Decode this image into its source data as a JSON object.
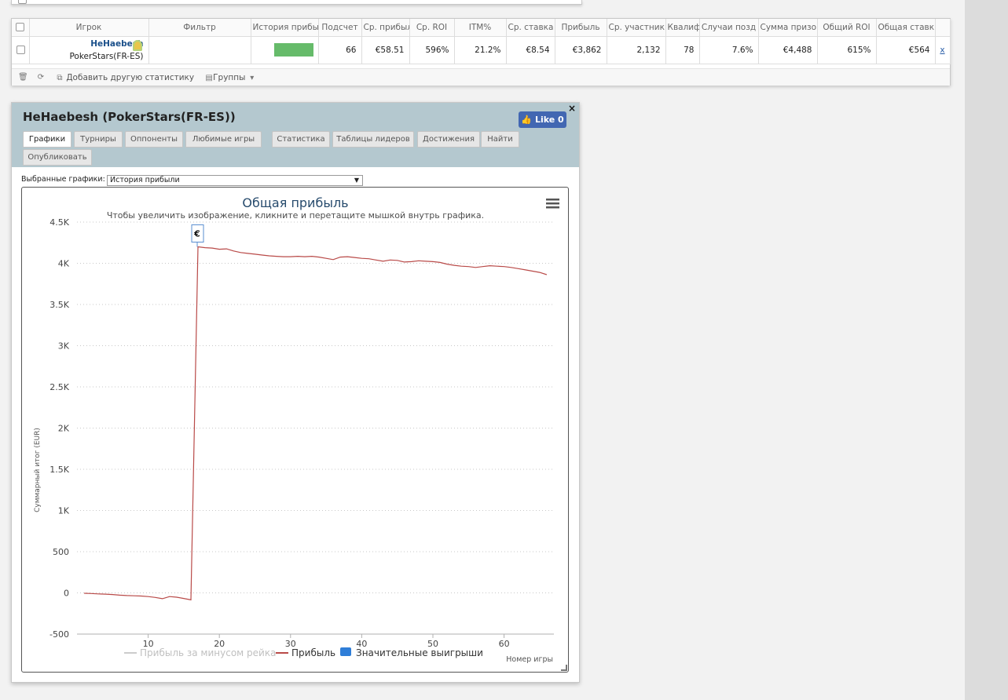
{
  "stats_table": {
    "headers": [
      "Игрок",
      "Фильтр",
      "История прибы",
      "Подсчет",
      "Ср. прибыл",
      "Ср. ROI",
      "ITM%",
      "Ср. ставка",
      "Прибыль",
      "Ср. участник",
      "Квалиф",
      "Случаи позд",
      "Сумма призо",
      "Общий ROI",
      "Общая ставк"
    ],
    "row": {
      "player_name": "HeHaebesh",
      "player_site": "PokerStars(FR-ES)",
      "filter": "",
      "count": "66",
      "avg_profit": "€58.51",
      "avg_roi": "596%",
      "itm": "21.2%",
      "avg_stake": "€8.54",
      "profit": "€3,862",
      "avg_entrants": "2,132",
      "qualif": "78",
      "late_cases": "7.6%",
      "prize_sum": "€4,488",
      "total_roi": "615%",
      "total_stake": "€564",
      "remove_link": "x"
    },
    "footer": {
      "add_stat": "Добавить другую статистику",
      "groups": "Группы"
    }
  },
  "chart_window": {
    "title": "HeHaebesh (PokerStars(FR-ES))",
    "close": "×",
    "like_label": "Like 0",
    "tabs": [
      "Графики",
      "Турниры",
      "Оппоненты",
      "Любимые игры",
      "Статистика",
      "Таблицы лидеров",
      "Достижения",
      "Найти",
      "Опубликовать"
    ],
    "active_tab": "Графики",
    "selector_label": "Выбранные графики:",
    "selector_value": "История прибыли"
  },
  "chart_data": {
    "type": "line",
    "title": "Общая прибыль",
    "subtitle": "Чтобы увеличить изображение, кликните и перетащите мышкой внутрь графика.",
    "xlabel": "Номер игры",
    "ylabel": "Суммарный итог (EUR)",
    "xlim": [
      0,
      67
    ],
    "ylim": [
      -500,
      4500
    ],
    "x_ticks": [
      10,
      20,
      30,
      40,
      50,
      60
    ],
    "y_ticks": [
      -500,
      0,
      500,
      1000,
      1500,
      2000,
      2500,
      3000,
      3500,
      4000,
      4500
    ],
    "y_tick_labels": [
      "-500",
      "0",
      "500",
      "1K",
      "1.5K",
      "2K",
      "2.5K",
      "3K",
      "3.5K",
      "4K",
      "4.5K"
    ],
    "grid": true,
    "tooltip_marker": "€",
    "tooltip_x": 17,
    "legend": [
      {
        "label": "Прибыль за минусом рейка",
        "color": "#cccccc",
        "kind": "line"
      },
      {
        "label": "Прибыль",
        "color": "#b94a48",
        "kind": "line"
      },
      {
        "label": "Значительные выигрыши",
        "color": "#2f7ed8",
        "kind": "box"
      }
    ],
    "series": [
      {
        "name": "Прибыль",
        "color": "#b94a48",
        "x": [
          1,
          2,
          3,
          4,
          5,
          6,
          7,
          8,
          9,
          10,
          11,
          12,
          13,
          14,
          15,
          16,
          17,
          18,
          19,
          20,
          21,
          22,
          23,
          24,
          25,
          26,
          27,
          28,
          29,
          30,
          31,
          32,
          33,
          34,
          35,
          36,
          37,
          38,
          39,
          40,
          41,
          42,
          43,
          44,
          45,
          46,
          47,
          48,
          49,
          50,
          51,
          52,
          53,
          54,
          55,
          56,
          57,
          58,
          59,
          60,
          61,
          62,
          63,
          64,
          65,
          66
        ],
        "values": [
          -5,
          -8,
          -12,
          -15,
          -20,
          -28,
          -32,
          -35,
          -38,
          -45,
          -55,
          -70,
          -45,
          -52,
          -68,
          -85,
          4200,
          4190,
          4185,
          4170,
          4175,
          4150,
          4130,
          4120,
          4110,
          4100,
          4090,
          4085,
          4080,
          4080,
          4085,
          4080,
          4085,
          4075,
          4060,
          4045,
          4075,
          4080,
          4070,
          4060,
          4055,
          4040,
          4025,
          4040,
          4035,
          4015,
          4020,
          4030,
          4025,
          4020,
          4010,
          3990,
          3975,
          3965,
          3960,
          3950,
          3960,
          3970,
          3965,
          3960,
          3950,
          3935,
          3920,
          3905,
          3890,
          3862
        ]
      }
    ]
  }
}
